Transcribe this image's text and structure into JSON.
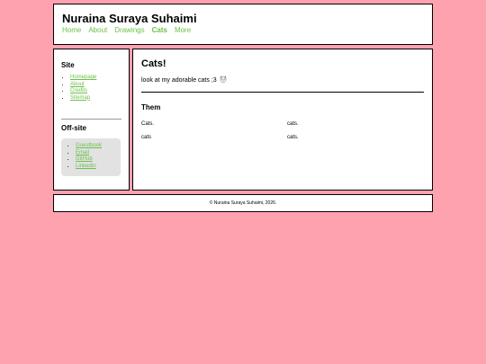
{
  "header": {
    "title": "Nuraina Suraya Suhaimi",
    "nav": [
      "Home",
      "About",
      "Drawings",
      "Cats",
      "More"
    ],
    "active": "Cats"
  },
  "sidebar": {
    "site_heading": "Site",
    "site_links": [
      "Homepage",
      "About",
      "Credits",
      "Sitemap"
    ],
    "offsite_heading": "Off-site",
    "offsite_links": [
      "Guestbook",
      "Email",
      "GitHub",
      "LinkedIn"
    ]
  },
  "main": {
    "title": "Cats!",
    "intro": "look at my adorable cats ;3",
    "emoji": "cat-face-icon",
    "section_heading": "Them",
    "grid": [
      [
        "Cats.",
        "cats."
      ],
      [
        "cats",
        "cats."
      ]
    ]
  },
  "footer": {
    "text": "© Nuraina Suraya Suhaimi, 2026."
  },
  "colors": {
    "background": "#ffa2b0",
    "link": "#6cc04a",
    "panel": "#e2e2e2"
  }
}
